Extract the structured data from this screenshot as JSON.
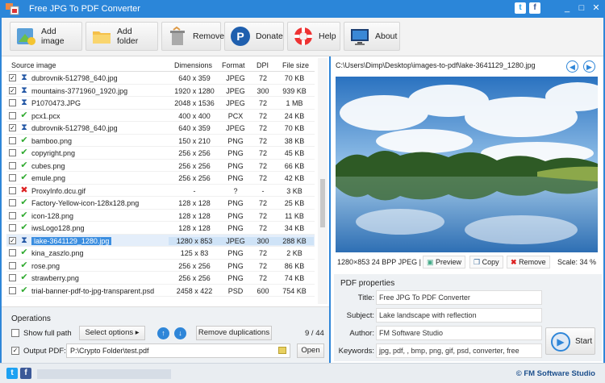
{
  "window": {
    "title": "Free JPG To PDF Converter",
    "controls": [
      "_",
      "□",
      "✕"
    ]
  },
  "toolbar": [
    {
      "label": "Add image",
      "icon": "add-image-icon"
    },
    {
      "label": "Add folder",
      "icon": "folder-icon"
    },
    {
      "label": "Remove",
      "icon": "trash-icon"
    },
    {
      "label": "Donate",
      "icon": "paypal-icon"
    },
    {
      "label": "Help",
      "icon": "lifebuoy-icon"
    },
    {
      "label": "About",
      "icon": "monitor-icon"
    }
  ],
  "table": {
    "headers": {
      "name": "Source image",
      "dim": "Dimensions",
      "fmt": "Format",
      "dpi": "DPI",
      "size": "File size"
    },
    "rows": [
      {
        "checked": true,
        "status": "pending",
        "name": "dubrovnik-512798_640.jpg",
        "dim": "640 x 359",
        "fmt": "JPEG",
        "dpi": "72",
        "size": "70 KB"
      },
      {
        "checked": true,
        "status": "pending",
        "name": "mountains-3771960_1920.jpg",
        "dim": "1920 x 1280",
        "fmt": "JPEG",
        "dpi": "300",
        "size": "939 KB"
      },
      {
        "checked": false,
        "status": "pending",
        "name": "P1070473.JPG",
        "dim": "2048 x 1536",
        "fmt": "JPEG",
        "dpi": "72",
        "size": "1 MB"
      },
      {
        "checked": false,
        "status": "ok",
        "name": "pcx1.pcx",
        "dim": "400 x 400",
        "fmt": "PCX",
        "dpi": "72",
        "size": "24 KB"
      },
      {
        "checked": true,
        "status": "pending",
        "name": "dubrovnik-512798_640.jpg",
        "dim": "640 x 359",
        "fmt": "JPEG",
        "dpi": "72",
        "size": "70 KB"
      },
      {
        "checked": false,
        "status": "ok",
        "name": "bamboo.png",
        "dim": "150 x 210",
        "fmt": "PNG",
        "dpi": "72",
        "size": "38 KB"
      },
      {
        "checked": false,
        "status": "ok",
        "name": "copyright.png",
        "dim": "256 x 256",
        "fmt": "PNG",
        "dpi": "72",
        "size": "45 KB"
      },
      {
        "checked": false,
        "status": "ok",
        "name": "cubes.png",
        "dim": "256 x 256",
        "fmt": "PNG",
        "dpi": "72",
        "size": "66 KB"
      },
      {
        "checked": false,
        "status": "ok",
        "name": "emule.png",
        "dim": "256 x 256",
        "fmt": "PNG",
        "dpi": "72",
        "size": "42 KB"
      },
      {
        "checked": false,
        "status": "error",
        "name": "ProxyInfo.dcu.gif",
        "dim": "-",
        "fmt": "?",
        "dpi": "-",
        "size": "3 KB"
      },
      {
        "checked": false,
        "status": "ok",
        "name": "Factory-Yellow-icon-128x128.png",
        "dim": "128 x 128",
        "fmt": "PNG",
        "dpi": "72",
        "size": "25 KB"
      },
      {
        "checked": false,
        "status": "ok",
        "name": "icon-128.png",
        "dim": "128 x 128",
        "fmt": "PNG",
        "dpi": "72",
        "size": "11 KB"
      },
      {
        "checked": false,
        "status": "ok",
        "name": "iwsLogo128.png",
        "dim": "128 x 128",
        "fmt": "PNG",
        "dpi": "72",
        "size": "34 KB"
      },
      {
        "checked": true,
        "status": "pending",
        "name": "lake-3641129_1280.jpg",
        "dim": "1280 x 853",
        "fmt": "JPEG",
        "dpi": "300",
        "size": "288 KB",
        "selected": true
      },
      {
        "checked": false,
        "status": "ok",
        "name": "kina_zaszlo.png",
        "dim": "125 x 83",
        "fmt": "PNG",
        "dpi": "72",
        "size": "2 KB"
      },
      {
        "checked": false,
        "status": "ok",
        "name": "rose.png",
        "dim": "256 x 256",
        "fmt": "PNG",
        "dpi": "72",
        "size": "86 KB"
      },
      {
        "checked": false,
        "status": "ok",
        "name": "strawberry.png",
        "dim": "256 x 256",
        "fmt": "PNG",
        "dpi": "72",
        "size": "74 KB"
      },
      {
        "checked": false,
        "status": "ok",
        "name": "trial-banner-pdf-to-jpg-transparent.psd",
        "dim": "2458 x 422",
        "fmt": "PSD",
        "dpi": "600",
        "size": "754 KB"
      }
    ]
  },
  "operations": {
    "title": "Operations",
    "show_full_path": "Show full path",
    "select_options": "Select options",
    "remove_duplications": "Remove duplications",
    "count": "9 / 44",
    "output_pdf_label": "Output PDF:",
    "output_pdf_value": "P:\\Crypto Folder\\test.pdf",
    "open": "Open"
  },
  "preview": {
    "path": "C:\\Users\\Dimp\\Desktop\\images-to-pdf\\lake-3641129_1280.jpg",
    "info": "1280×853  24 BPP  JPEG |",
    "preview_btn": "Preview",
    "copy_btn": "Copy",
    "remove_btn": "Remove",
    "scale": "Scale: 34 %"
  },
  "pdf": {
    "title": "PDF properties",
    "fields": [
      {
        "label": "Title:",
        "value": "Free JPG To PDF Converter"
      },
      {
        "label": "Subject:",
        "value": "Lake landscape with reflection"
      },
      {
        "label": "Author:",
        "value": "FM Software Studio"
      },
      {
        "label": "Keywords:",
        "value": "jpg, pdf, , bmp, png, gif, psd, converter, free"
      }
    ],
    "start": "Start"
  },
  "status": {
    "brand": "© FM Software Studio"
  },
  "colors": {
    "accent": "#2f86d8",
    "selected_row": "#3b8ee0"
  }
}
